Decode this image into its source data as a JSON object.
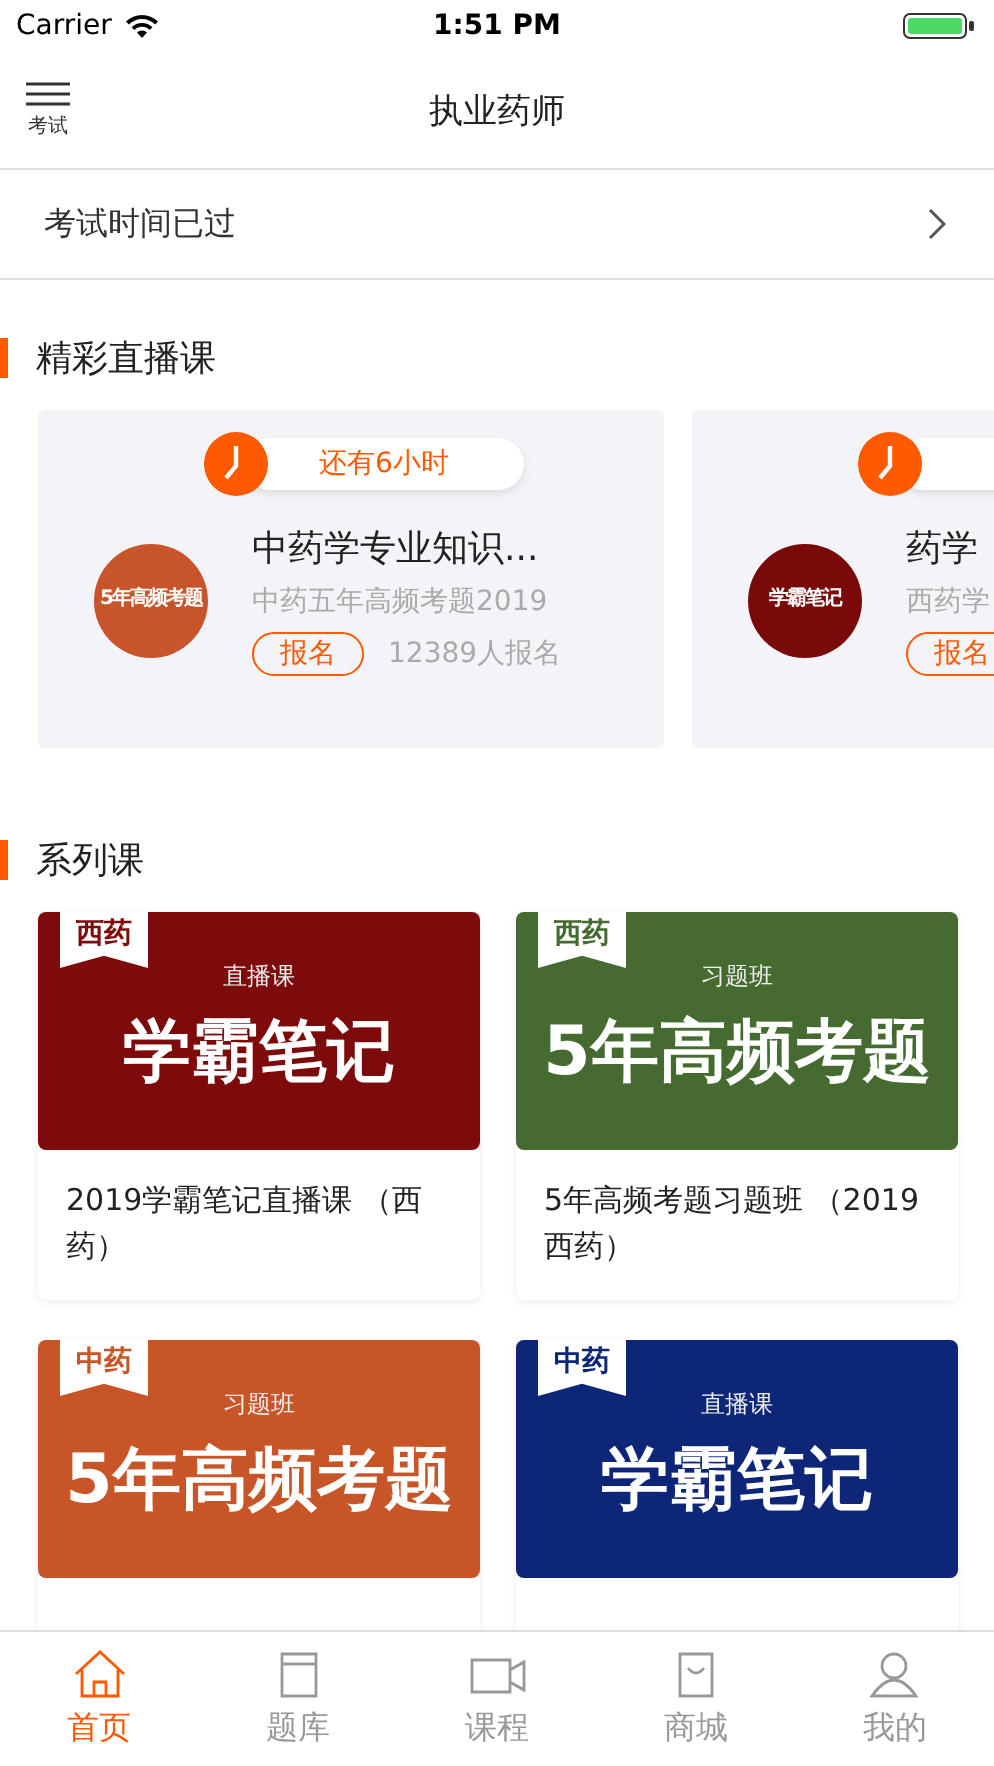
{
  "status_bar": {
    "carrier": "Carrier",
    "time": "1:51 PM"
  },
  "nav": {
    "menu_label": "考试",
    "title": "执业药师"
  },
  "exam_row": {
    "text": "考试时间已过"
  },
  "live_section": {
    "title": "精彩直播课",
    "cards": [
      {
        "timer": "还有6小时",
        "title": "中药学专业知识...",
        "subtitle": "中药五年高频考题2019",
        "button": "报名",
        "count": "12389人报名",
        "thumb_title": "5年高频考题",
        "color": "#c8552a"
      },
      {
        "title": "药学",
        "subtitle": "西药学",
        "button": "报名",
        "thumb_title": "学霸笔记",
        "color": "#7a0a0a"
      }
    ]
  },
  "series_section": {
    "title": "系列课",
    "courses": [
      {
        "tag": "西药",
        "kind_label": "直播课",
        "banner": "学霸笔记",
        "color": "#7d0b0b",
        "title": "2019学霸笔记直播课 （西药）"
      },
      {
        "tag": "西药",
        "kind_label": "习题班",
        "banner": "5年高频考题",
        "color": "#456b30",
        "title": "5年高频考题习题班 （2019西药）"
      },
      {
        "tag": "中药",
        "kind_label": "习题班",
        "banner": "5年高频考题",
        "color": "#c85527"
      },
      {
        "tag": "中药",
        "kind_label": "直播课",
        "banner": "学霸笔记",
        "color": "#0d2677"
      }
    ]
  },
  "tab_bar": [
    {
      "label": "首页",
      "selected": true
    },
    {
      "label": "题库",
      "selected": false
    },
    {
      "label": "课程",
      "selected": false
    },
    {
      "label": "商城",
      "selected": false
    },
    {
      "label": "我的",
      "selected": false
    }
  ]
}
